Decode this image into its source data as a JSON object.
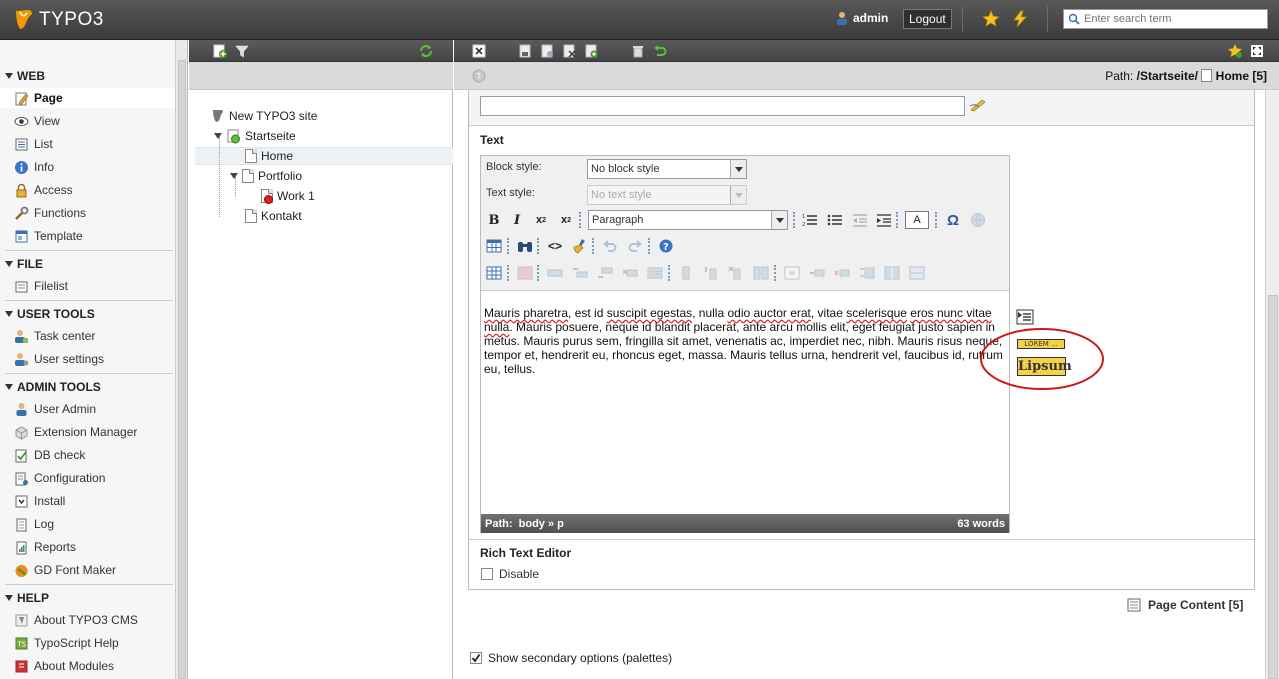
{
  "topbar": {
    "brand": "TYPO3",
    "user": "admin",
    "logout": "Logout",
    "search_placeholder": "Enter search term"
  },
  "modmenu": {
    "groups": [
      {
        "label": "WEB",
        "items": [
          "Page",
          "View",
          "List",
          "Info",
          "Access",
          "Functions",
          "Template"
        ]
      },
      {
        "label": "FILE",
        "items": [
          "Filelist"
        ]
      },
      {
        "label": "USER TOOLS",
        "items": [
          "Task center",
          "User settings"
        ]
      },
      {
        "label": "ADMIN TOOLS",
        "items": [
          "User Admin",
          "Extension Manager",
          "DB check",
          "Configuration",
          "Install",
          "Log",
          "Reports",
          "GD Font Maker"
        ]
      },
      {
        "label": "HELP",
        "items": [
          "About TYPO3 CMS",
          "TypoScript Help",
          "About Modules"
        ]
      }
    ],
    "active": "Page"
  },
  "tree": {
    "root": "New TYPO3 site",
    "nodes": [
      "Startseite",
      "Home",
      "Portfolio",
      "Work 1",
      "Kontakt"
    ]
  },
  "doc": {
    "path_label": "Path:",
    "path_value": "/Startseite/",
    "path_page": "Home [5]",
    "text_section": "Text",
    "block_style_label": "Block style:",
    "block_style_value": "No block style",
    "text_style_label": "Text style:",
    "text_style_value": "No text style",
    "paragraph_value": "Paragraph",
    "char_btn": "A",
    "body_p1": "Mauris pharetra",
    "body_p2": ", est id ",
    "body_p3": "suscipit egestas",
    "body_p4": ", nulla ",
    "body_p5": "odio auctor erat",
    "body_p6": ", vitae ",
    "body_p7": "scelerisque",
    "body_p8": "eros nunc vitae nulla",
    "body_p9": ". Mauris posuere, neque id blandit placerat, ante arcu mollis elit, eget feugiat justo sapien in metus. Mauris purus sem, fringilla sit amet, venenatis ac, imperdiet nec, nibh. Mauris risus neque, tempor et, hendrerit eu, rhoncus eget, massa. Mauris tellus urna, hendrerit vel, faucibus id, rutrum eu, tellus.",
    "status_path_label": "Path:",
    "status_path": "body » p",
    "word_count": "63 words",
    "lorem_small": "LOREM ...",
    "lipsum": "Lipsum",
    "rte_section": "Rich Text Editor",
    "disable_label": "Disable",
    "page_content": "Page Content [5]",
    "secondary_options": "Show secondary options (palettes)"
  }
}
